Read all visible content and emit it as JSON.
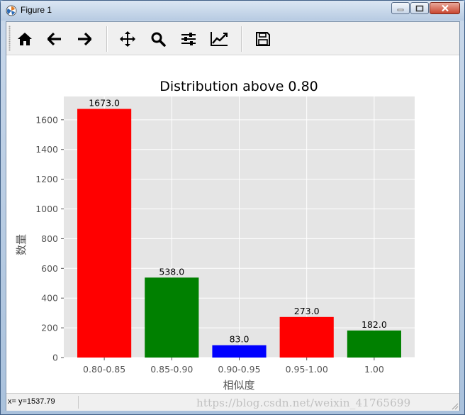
{
  "window": {
    "title": "Figure 1"
  },
  "toolbar": {
    "buttons": [
      {
        "name": "home-button",
        "icon": "home-icon"
      },
      {
        "name": "back-button",
        "icon": "arrow-left-icon"
      },
      {
        "name": "forward-button",
        "icon": "arrow-right-icon"
      },
      {
        "name": "pan-button",
        "icon": "move-icon"
      },
      {
        "name": "zoom-button",
        "icon": "magnifier-icon"
      },
      {
        "name": "subplots-button",
        "icon": "sliders-icon"
      },
      {
        "name": "edit-axis-button",
        "icon": "line-chart-icon"
      },
      {
        "name": "save-button",
        "icon": "floppy-disk-icon"
      }
    ]
  },
  "status": {
    "coords": "x= y=1537.79",
    "watermark": "https://blog.csdn.net/weixin_41765699"
  },
  "colors": {
    "red": "#ff0000",
    "green": "#008000",
    "blue": "#0000ff",
    "axes_bg": "#e5e5e5",
    "grid": "#ffffff"
  },
  "chart_data": {
    "type": "bar",
    "title": "Distribution above 0.80",
    "xlabel": "相似度",
    "ylabel": "数量",
    "categories": [
      "0.80-0.85",
      "0.85-0.90",
      "0.90-0.95",
      "0.95-1.00",
      "1.00"
    ],
    "values": [
      1673,
      538,
      83,
      273,
      182
    ],
    "data_labels": [
      "1673.0",
      "538.0",
      "83.0",
      "273.0",
      "182.0"
    ],
    "bar_colors": [
      "#ff0000",
      "#008000",
      "#0000ff",
      "#ff0000",
      "#008000"
    ],
    "yticks": [
      0,
      200,
      400,
      600,
      800,
      1000,
      1200,
      1400,
      1600
    ],
    "ylim": [
      0,
      1756.65
    ],
    "grid": true,
    "style": "ggplot"
  }
}
